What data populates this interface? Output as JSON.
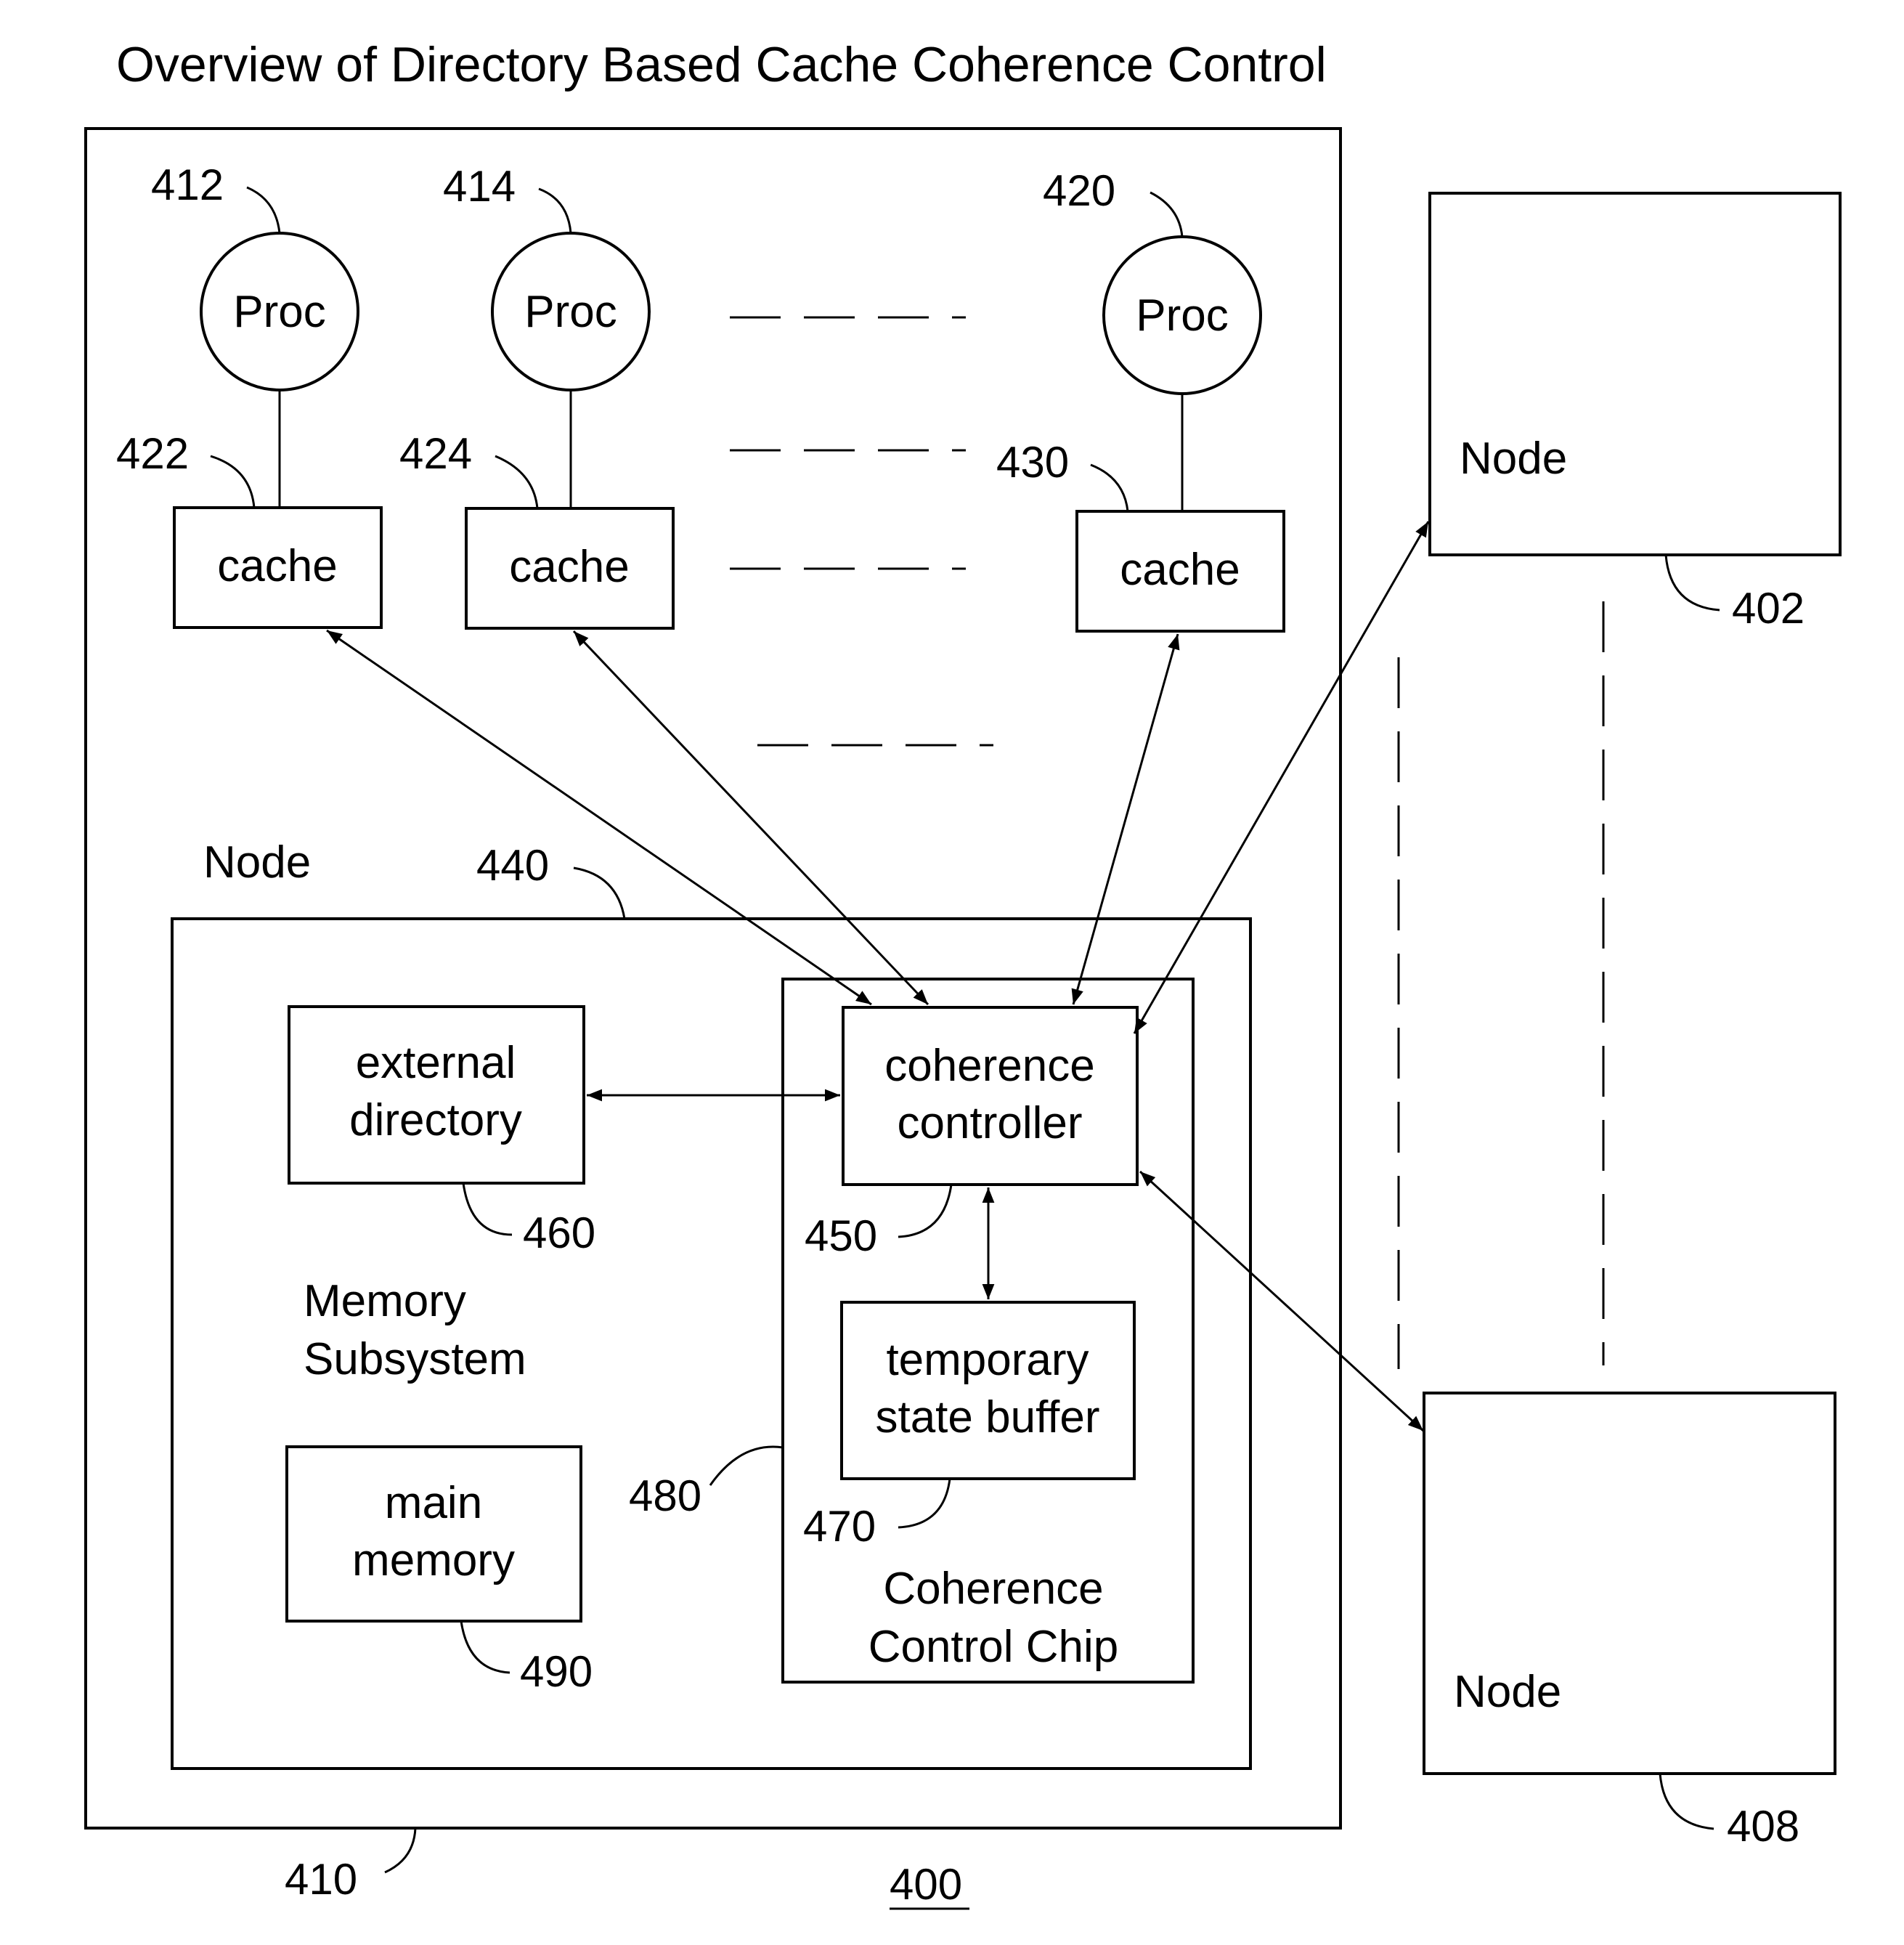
{
  "title": "Overview of Directory Based Cache Coherence Control",
  "figure_number": "400",
  "system": {
    "node_label": "Node",
    "ref": "410",
    "processors": [
      {
        "label": "Proc",
        "ref": "412",
        "cache_label": "cache",
        "cache_ref": "422"
      },
      {
        "label": "Proc",
        "ref": "414",
        "cache_label": "cache",
        "cache_ref": "424"
      },
      {
        "label": "Proc",
        "ref": "420",
        "cache_label": "cache",
        "cache_ref": "430"
      }
    ],
    "inner_node": {
      "label": "Node",
      "ref": "440",
      "memory_subsystem": [
        "Memory",
        "Subsystem"
      ],
      "external_directory": {
        "lines": [
          "external",
          "directory"
        ],
        "ref": "460"
      },
      "main_memory": {
        "lines": [
          "main",
          "memory"
        ],
        "ref": "490"
      },
      "chip": {
        "lines": [
          "Coherence",
          "Control Chip"
        ],
        "ref": "480",
        "controller": {
          "lines": [
            "coherence",
            "controller"
          ],
          "ref": "450"
        },
        "buffer": {
          "lines": [
            "temporary",
            "state buffer"
          ],
          "ref": "470"
        }
      }
    }
  },
  "remote_nodes": [
    {
      "label": "Node",
      "ref": "402"
    },
    {
      "label": "Node",
      "ref": "408"
    }
  ]
}
